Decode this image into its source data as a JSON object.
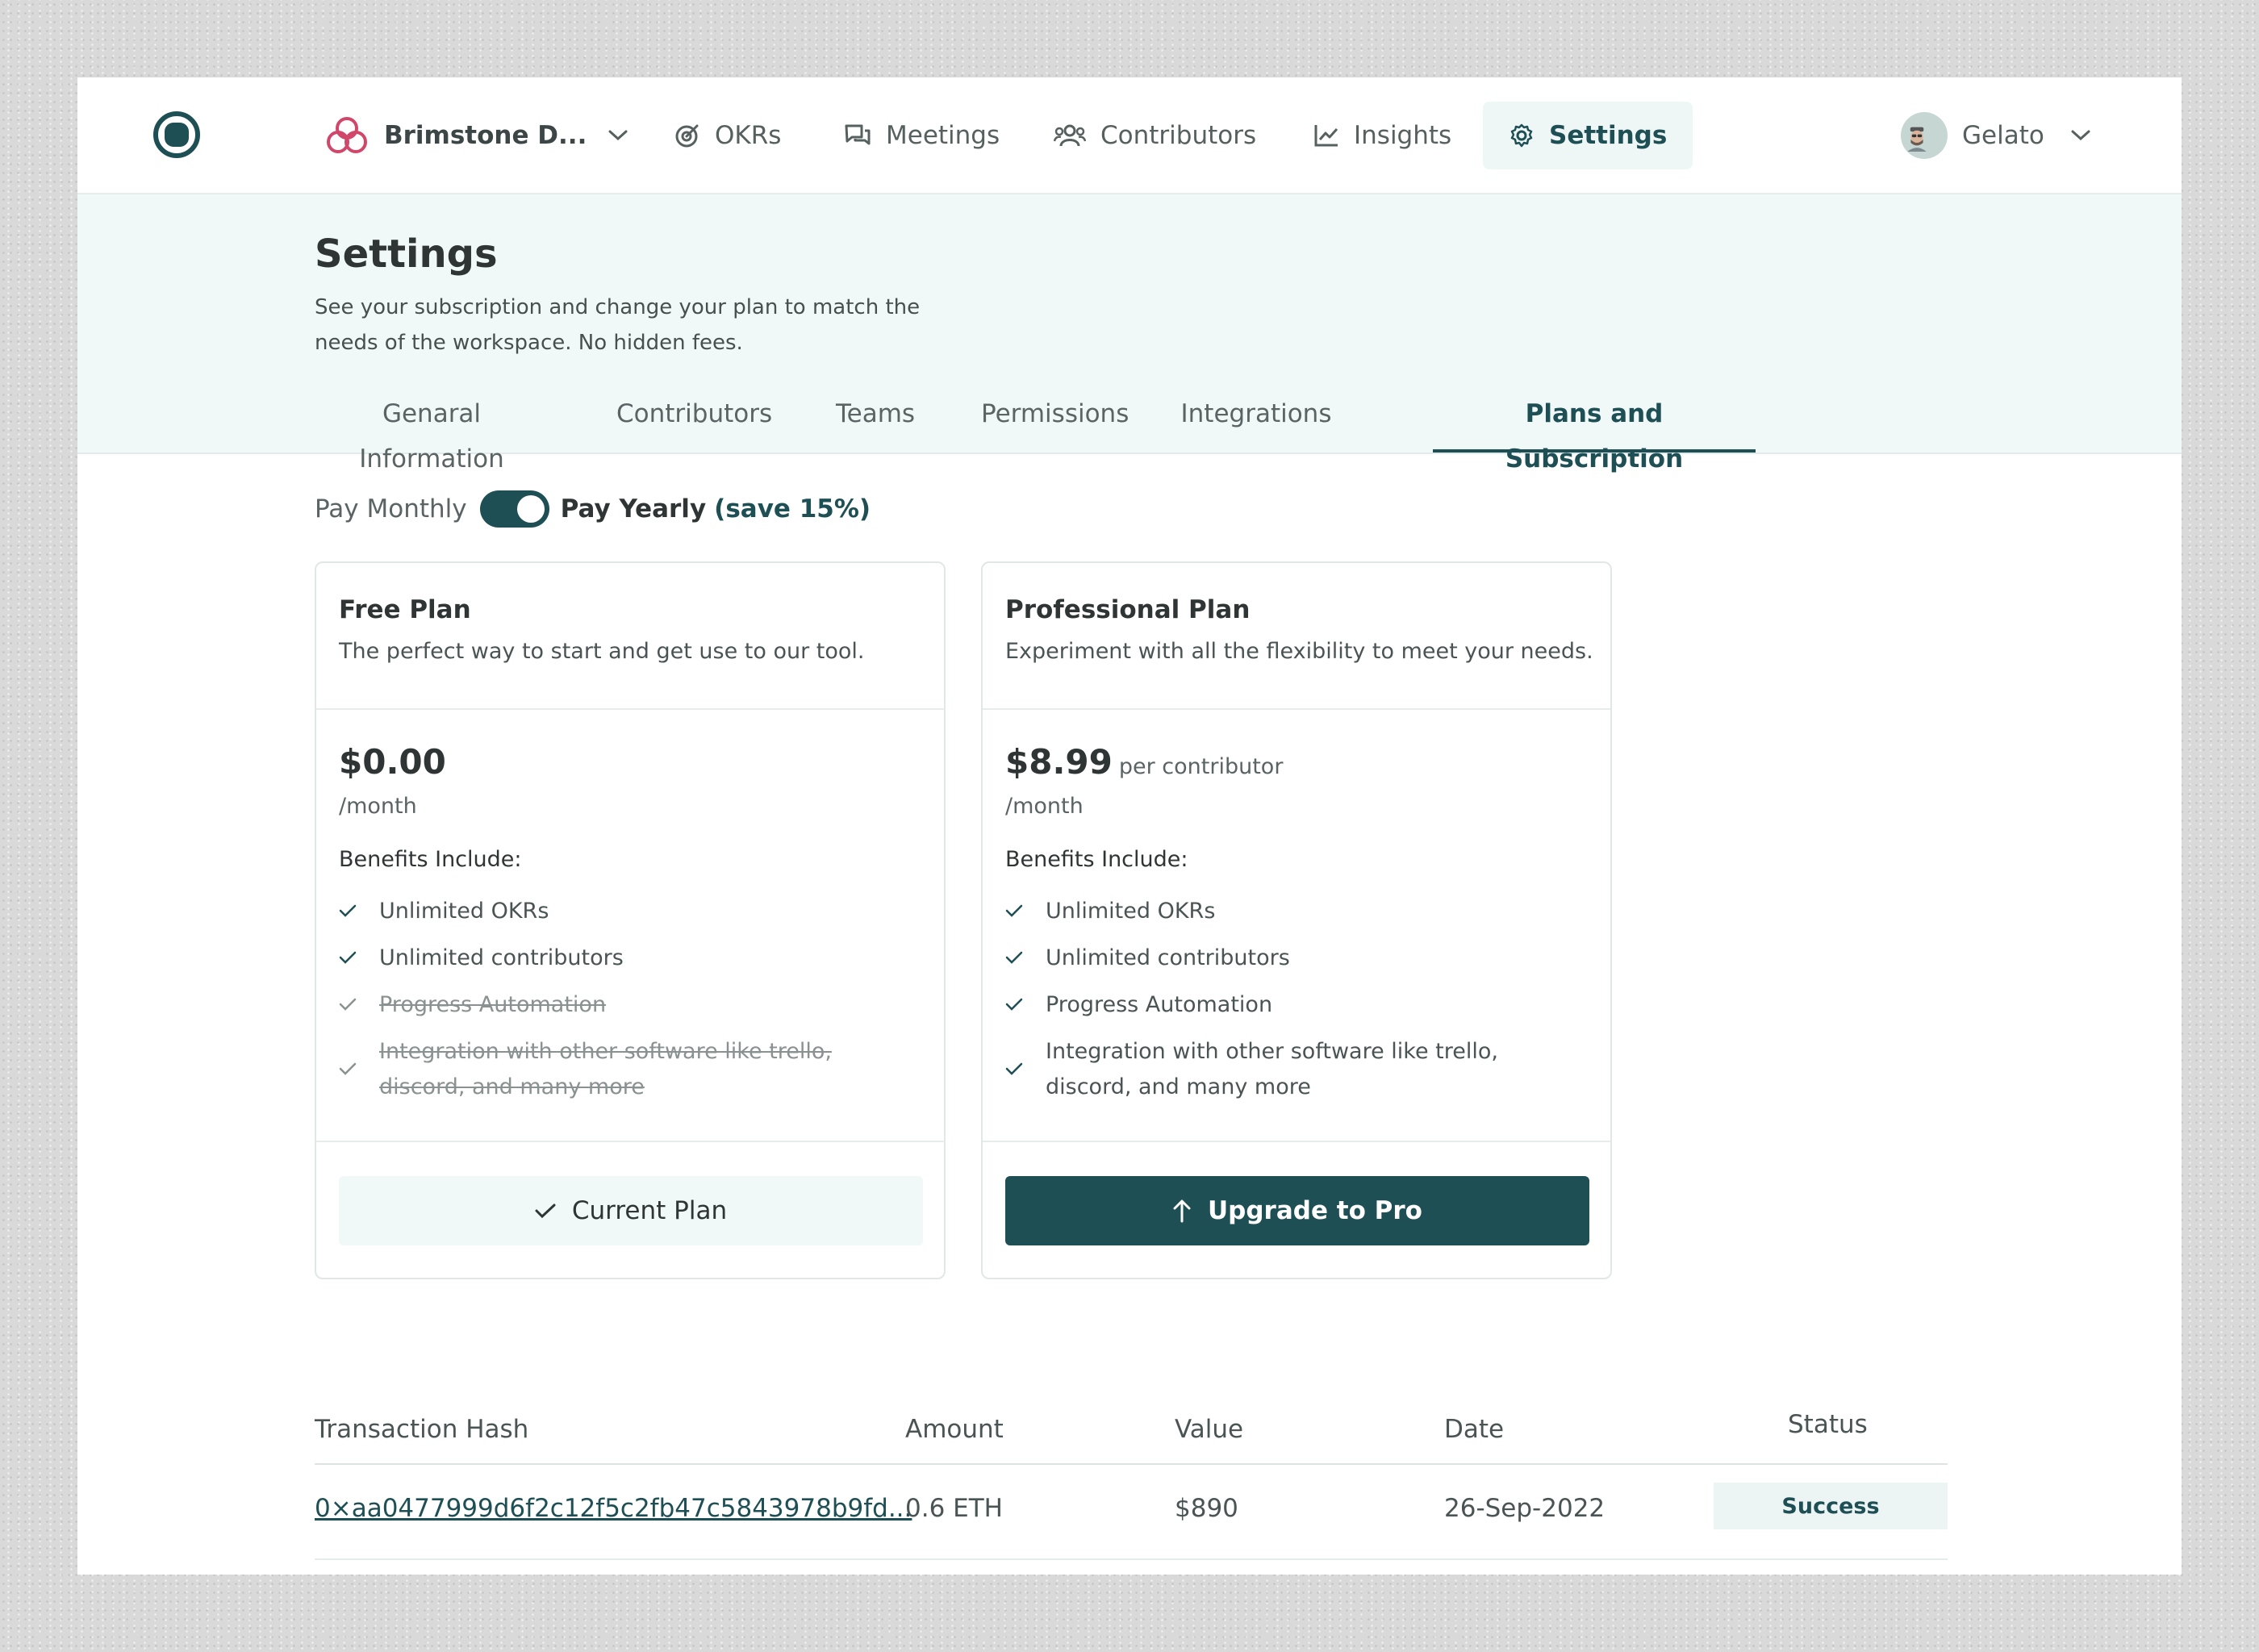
{
  "nav": {
    "workspace": "Brimstone D...",
    "items": [
      "OKRs",
      "Meetings",
      "Contributors",
      "Insights",
      "Settings"
    ],
    "user": "Gelato",
    "icons": {
      "workspace": "workspace-logo-icon",
      "okrs": "target-icon",
      "meetings": "chat-icon",
      "contributors": "users-icon",
      "insights": "chart-line-icon",
      "settings": "gear-icon"
    }
  },
  "header": {
    "title": "Settings",
    "description": "See your subscription and change your plan to match the needs of the workspace. No hidden fees.",
    "tabs": [
      "Genaral Information",
      "Contributors",
      "Teams",
      "Permissions",
      "Integrations",
      "Plans and Subscription"
    ],
    "active_tab": "Plans and Subscription"
  },
  "billing": {
    "monthly": "Pay Monthly",
    "yearly": "Pay Yearly",
    "save": "(save 15%)",
    "yearly_selected": true
  },
  "plans": [
    {
      "title": "Free Plan",
      "subtitle": "The perfect way to start and get use to our tool.",
      "price": "$0.00",
      "price_note": "",
      "period": "/month",
      "benefits_label": "Benefits Include:",
      "benefits": [
        "Unlimited OKRs",
        "Unlimited contributors",
        "Progress Automation",
        "Integration with other software like trello, discord, and many more"
      ],
      "benefits_included": [
        true,
        true,
        false,
        false
      ],
      "button": "Current Plan"
    },
    {
      "title": "Professional Plan",
      "subtitle": "Experiment with all the flexibility to meet your needs.",
      "price": "$8.99",
      "price_note": "per contributor",
      "period": "/month",
      "benefits_label": "Benefits Include:",
      "benefits": [
        "Unlimited OKRs",
        "Unlimited contributors",
        "Progress Automation",
        "Integration with other software like trello, discord, and many more"
      ],
      "benefits_included": [
        true,
        true,
        true,
        true
      ],
      "button": "Upgrade to Pro"
    }
  ],
  "transactions": {
    "headers": [
      "Transaction Hash",
      "Amount",
      "Value",
      "Date",
      "Status"
    ],
    "rows": [
      {
        "hash": "0×aa0477999d6f2c12f5c2fb47c5843978b9fd...",
        "amount": "0.6 ETH",
        "value": "$890",
        "date": "26-Sep-2022",
        "status": "Success"
      }
    ]
  },
  "colors": {
    "primary": "#1e4f55",
    "header_bg": "#f0f8f8",
    "badge_bg": "#ecf5f4",
    "workspace_icon": "#d0476a"
  }
}
